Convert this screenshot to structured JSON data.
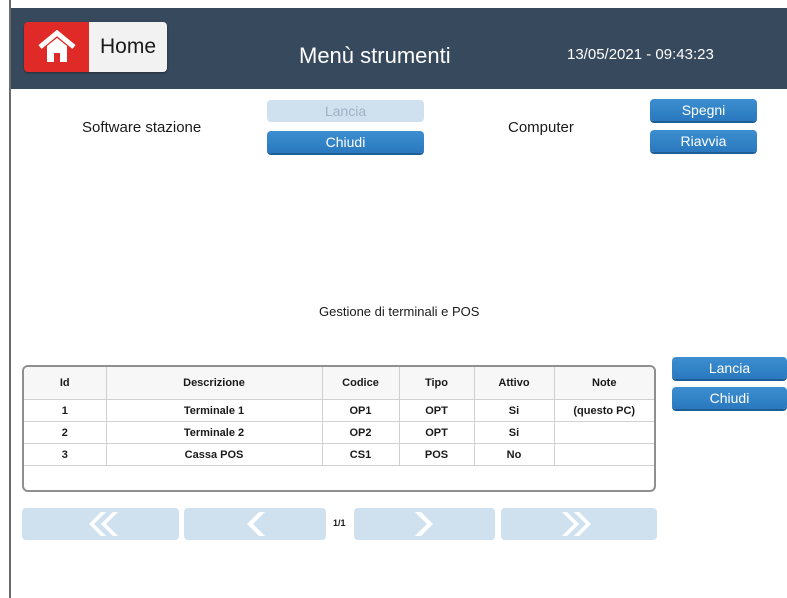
{
  "header": {
    "home_label": "Home",
    "title": "Menù strumenti",
    "datetime": "13/05/2021 - 09:43:23"
  },
  "software": {
    "label": "Software stazione",
    "launch": "Lancia",
    "close": "Chiudi"
  },
  "computer": {
    "label": "Computer",
    "shutdown": "Spegni",
    "restart": "Riavvia"
  },
  "terminals": {
    "section_title": "Gestione di terminali e POS",
    "launch": "Lancia",
    "close": "Chiudi",
    "columns": [
      "Id",
      "Descrizione",
      "Codice",
      "Tipo",
      "Attivo",
      "Note"
    ],
    "rows": [
      [
        "1",
        "Terminale 1",
        "OP1",
        "OPT",
        "Si",
        "(questo PC)"
      ],
      [
        "2",
        "Terminale 2",
        "OP2",
        "OPT",
        "Si",
        ""
      ],
      [
        "3",
        "Cassa POS",
        "CS1",
        "POS",
        "No",
        ""
      ]
    ]
  },
  "pagination": {
    "page": "1/1"
  },
  "colors": {
    "header_bg": "#37495c",
    "home_icon_bg": "#e02a27",
    "button_blue": "#2a78bf",
    "button_disabled": "#cfe0ee"
  }
}
